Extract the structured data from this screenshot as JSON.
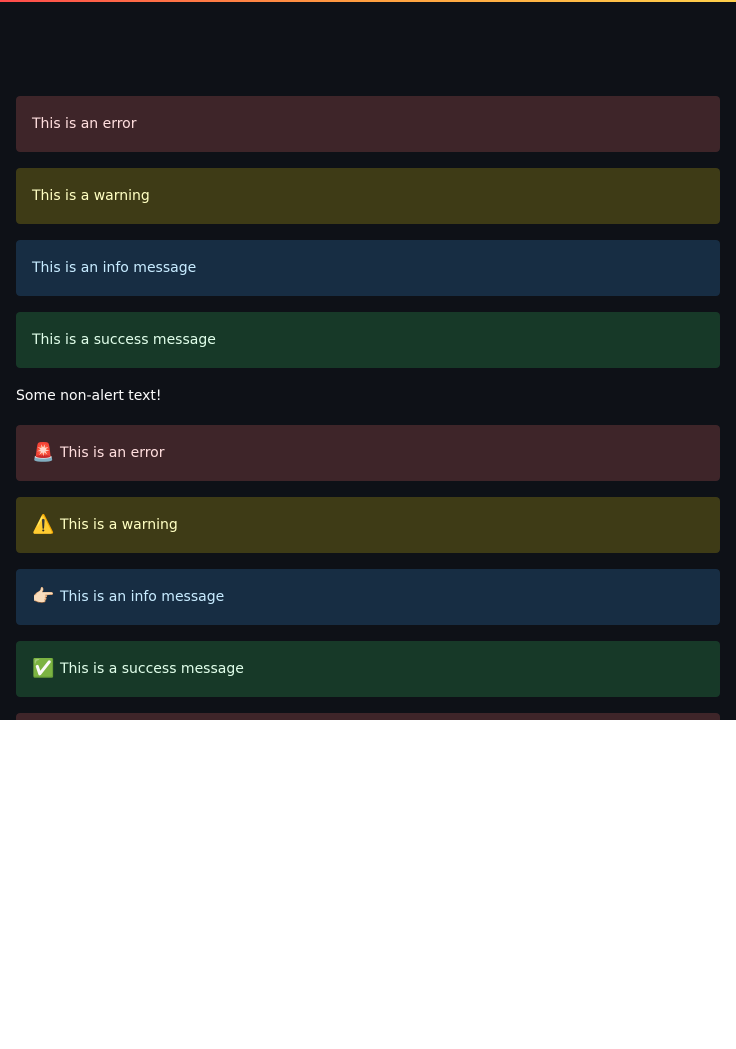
{
  "alerts_plain": [
    {
      "type": "error",
      "text": "This is an error"
    },
    {
      "type": "warning",
      "text": "This is a warning"
    },
    {
      "type": "info",
      "text": "This is an info message"
    },
    {
      "type": "success",
      "text": "This is a success message"
    }
  ],
  "plain_text": "Some non-alert text!",
  "alerts_icon": [
    {
      "type": "error",
      "icon": "🚨",
      "icon_name": "rotating-light-icon",
      "text": "This is an error"
    },
    {
      "type": "warning",
      "icon": "⚠️",
      "icon_name": "warning-icon",
      "text": "This is a warning"
    },
    {
      "type": "info",
      "icon": "👉🏻",
      "icon_name": "pointing-right-icon",
      "text": "This is an info message"
    },
    {
      "type": "success",
      "icon": "✅",
      "icon_name": "check-mark-icon",
      "text": "This is a success message"
    }
  ],
  "colors": {
    "background": "#0e1117",
    "error_bg": "#3e2529",
    "warning_bg": "#3e3b16",
    "info_bg": "#172d43",
    "success_bg": "#173928"
  }
}
